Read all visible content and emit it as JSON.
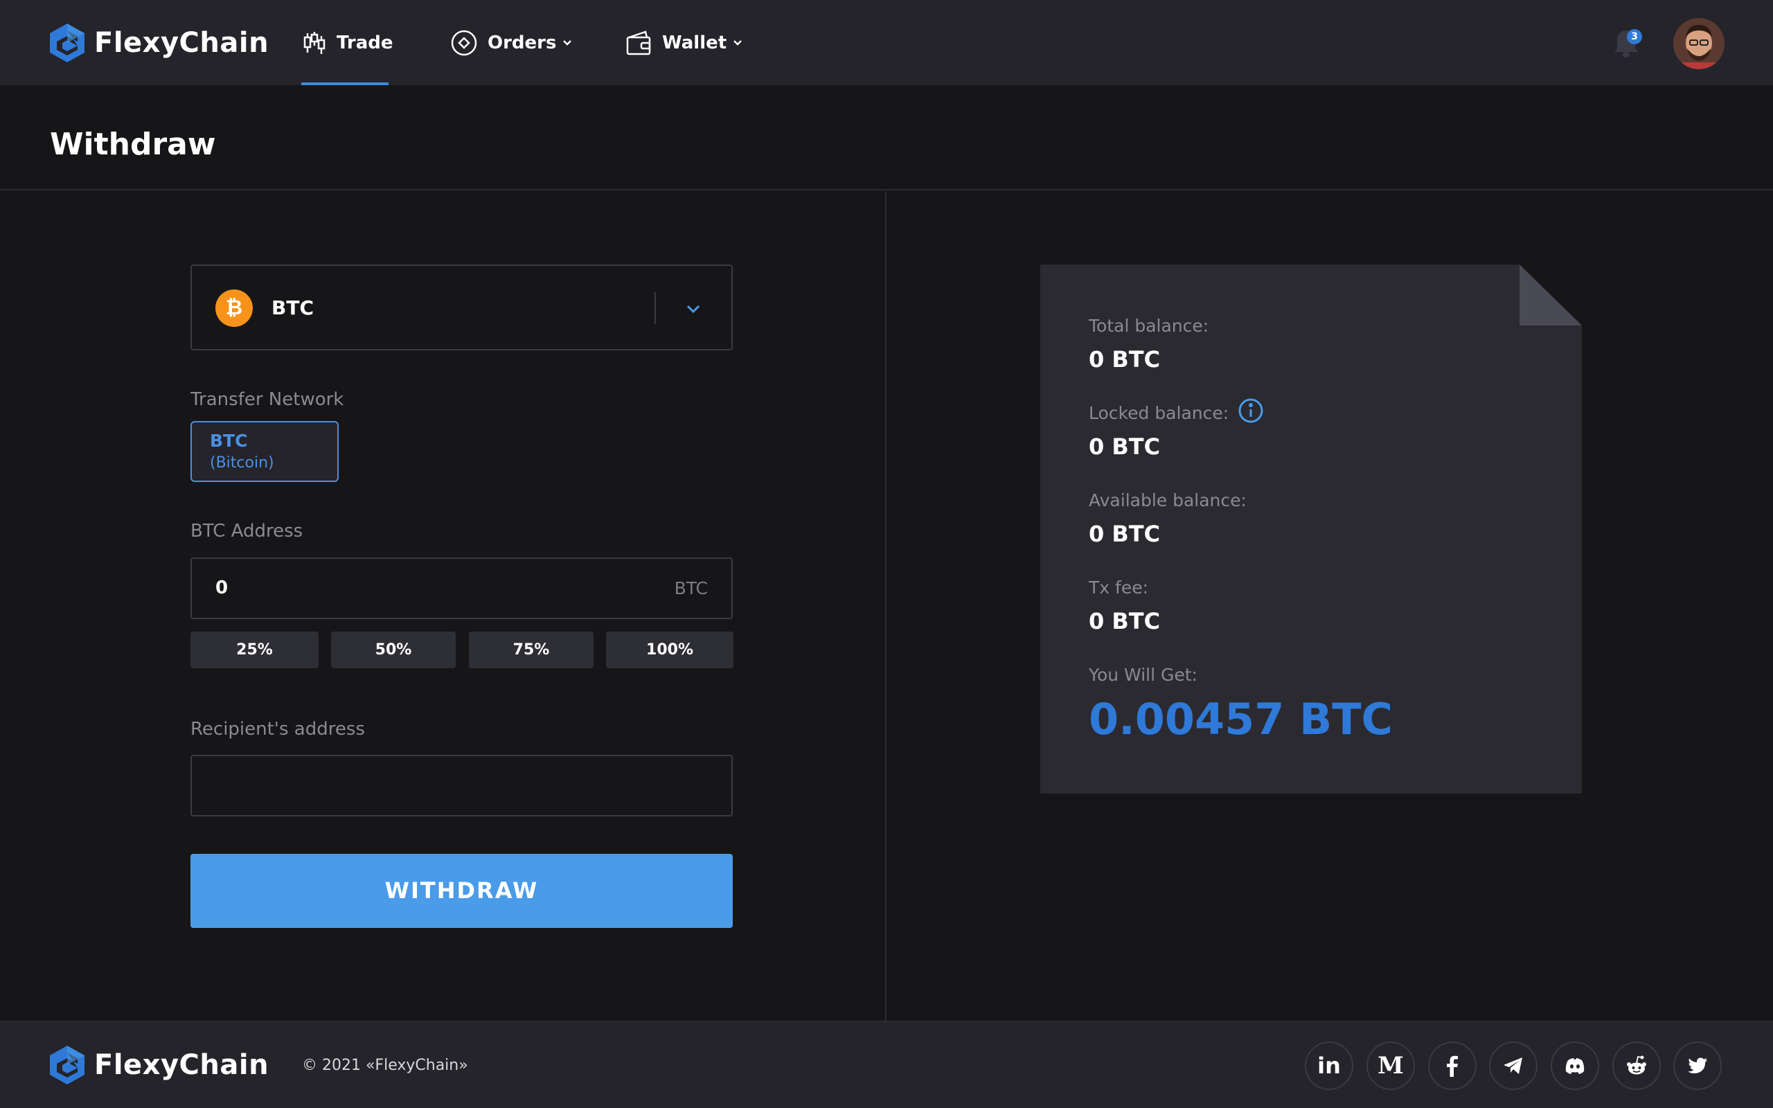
{
  "app": {
    "brand": "FlexyChain"
  },
  "nav": {
    "trade": "Trade",
    "orders": "Orders",
    "wallet": "Wallet"
  },
  "notifications": {
    "count": "3"
  },
  "page": {
    "title": "Withdraw"
  },
  "form": {
    "coin": {
      "symbol": "BTC",
      "icon_glyph": "₿"
    },
    "network_label": "Transfer Network",
    "network": {
      "code": "BTC",
      "name": "(Bitcoin)"
    },
    "address_label": "BTC Address",
    "amount": {
      "value": "0",
      "unit": "BTC"
    },
    "percent_buttons": [
      "25%",
      "50%",
      "75%",
      "100%"
    ],
    "recipient_label": "Recipient's address",
    "recipient_value": "",
    "submit_label": "WITHDRAW"
  },
  "balance": {
    "total_label": "Total balance:",
    "total_value": "0 BTC",
    "locked_label": "Locked balance:",
    "locked_value": "0 BTC",
    "available_label": "Available balance:",
    "available_value": "0 BTC",
    "fee_label": "Tx fee:",
    "fee_value": "0 BTC",
    "get_label": "You Will Get:",
    "get_value": "0.00457 BTC"
  },
  "footer": {
    "brand": "FlexyChain",
    "copyright": "© 2021 «FlexyChain»",
    "social_icons": [
      "linkedin-icon",
      "medium-icon",
      "facebook-icon",
      "telegram-icon",
      "discord-icon",
      "reddit-icon",
      "twitter-icon"
    ]
  },
  "colors": {
    "accent": "#4a9be8",
    "accent_dark": "#2f79d8",
    "bitcoin": "#f7931a",
    "background": "#161618",
    "panel": "#24242a"
  }
}
